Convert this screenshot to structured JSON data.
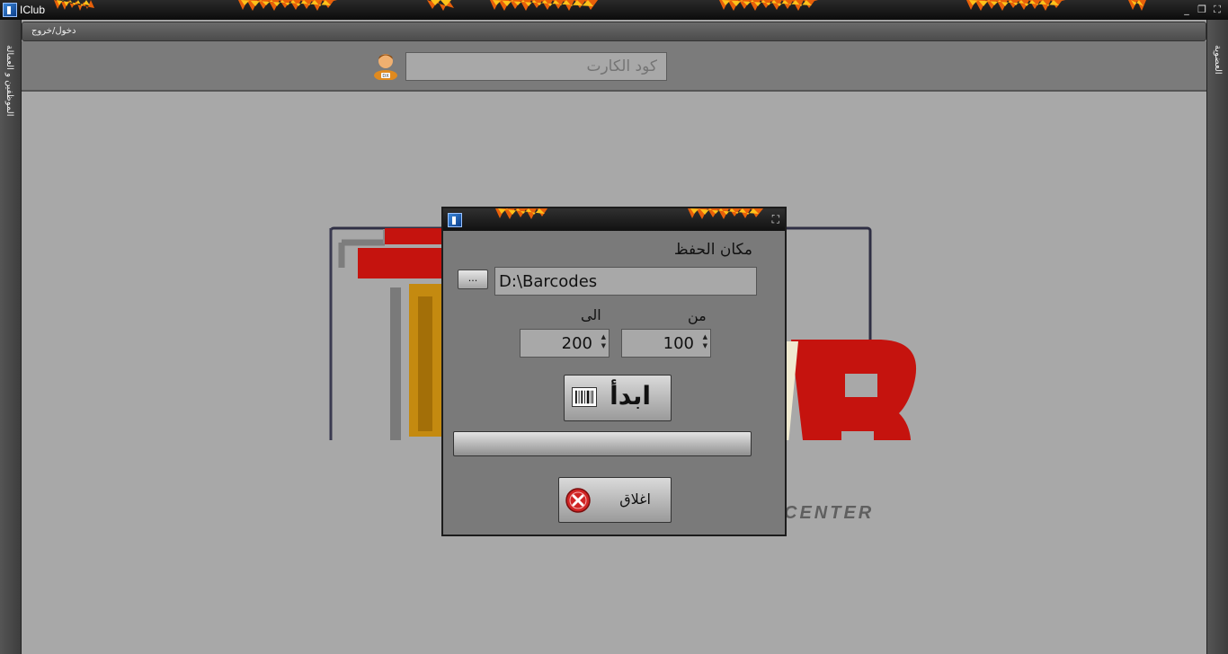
{
  "app": {
    "title": "IClub",
    "win_buttons": [
      "_",
      "❐",
      "⛶"
    ]
  },
  "sidebar": {
    "left_tab": "الموظفين و العمالة",
    "right_tab": "العضوية"
  },
  "menu": {
    "login_logout": "دخول/خروج"
  },
  "toolbar": {
    "card_code_placeholder": "كود الكارت"
  },
  "logo": {
    "center_text": "CENTER"
  },
  "dialog": {
    "save_location_label": "مكان الحفظ",
    "browse_label": "...",
    "path_value": "D:\\Barcodes",
    "from_label": "من",
    "to_label": "الى",
    "from_value": "100",
    "to_value": "200",
    "start_label": "ابدأ",
    "close_label": "اغلاق",
    "progress": 0,
    "max_icon": "⛶"
  }
}
